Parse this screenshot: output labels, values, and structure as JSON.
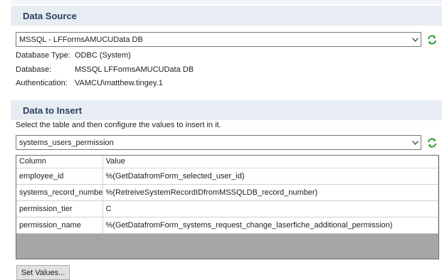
{
  "data_source": {
    "header": "Data Source",
    "selected": "MSSQL - LFFormsAMUCUData DB",
    "database_type_label": "Database Type:",
    "database_type_value": "ODBC (System)",
    "database_label": "Database:",
    "database_value": "MSSQL LFFormsAMUCUData DB",
    "authentication_label": "Authentication:",
    "authentication_value": "VAMCU\\matthew.tingey.1"
  },
  "data_to_insert": {
    "header": "Data to Insert",
    "instruction": "Select the table and then configure the values to insert in it.",
    "table_selected": "systems_users_permission",
    "grid": {
      "columns": [
        "Column",
        "Value"
      ],
      "rows": [
        {
          "column": "employee_id",
          "value": "%(GetDatafromForm_selected_user_id)"
        },
        {
          "column": "systems_record_number",
          "value": "%(RetreiveSystemRecordIDfromMSSQLDB_record_number)"
        },
        {
          "column": "permission_tier",
          "value": "C"
        },
        {
          "column": "permission_name",
          "value": "%(GetDatafromForm_systems_request_change_laserfiche_additional_permission)"
        }
      ]
    },
    "set_values_button": "Set Values..."
  },
  "icons": {
    "dropdown": "chevron-down-icon",
    "refresh": "refresh-icon"
  },
  "colors": {
    "section_header_bg": "#e8edf4",
    "section_header_text": "#2b3f5c",
    "refresh_icon": "#2e9e3a",
    "grid_empty_bg": "#a6a6a6"
  }
}
